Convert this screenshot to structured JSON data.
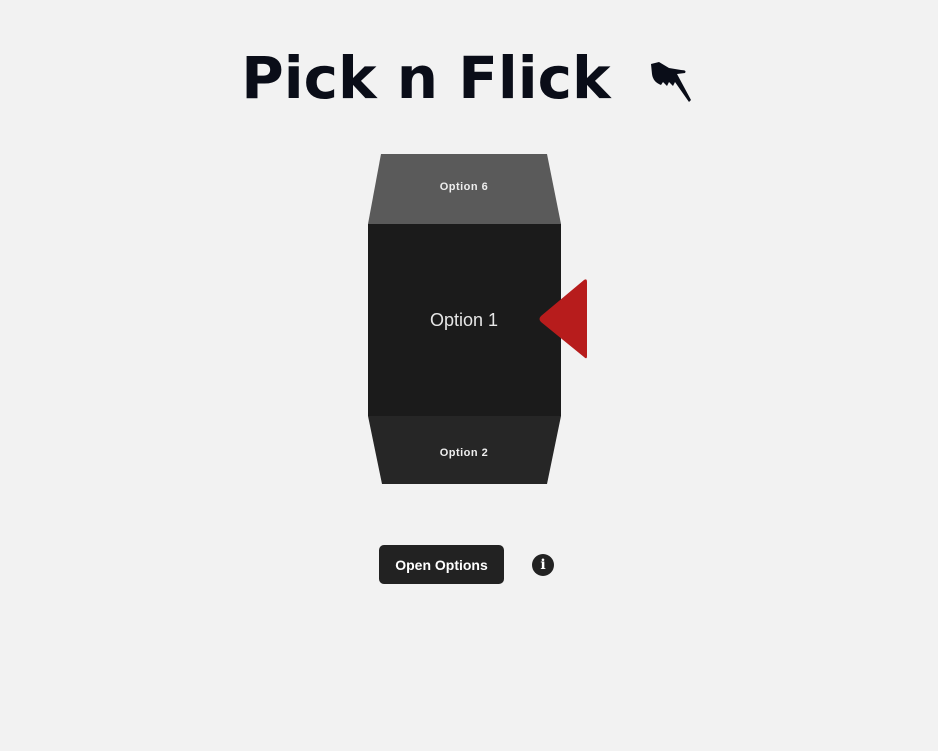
{
  "header": {
    "title": "Pick n Flick",
    "icon": "pointing-hand-icon"
  },
  "picker": {
    "faces": {
      "top": "Option 6",
      "front": "Option 1",
      "bottom": "Option 2"
    },
    "indicator_color": "#b71c1c",
    "indicator_icon": "triangle-left-icon"
  },
  "controls": {
    "open_options_label": "Open Options",
    "info_icon": "i"
  }
}
